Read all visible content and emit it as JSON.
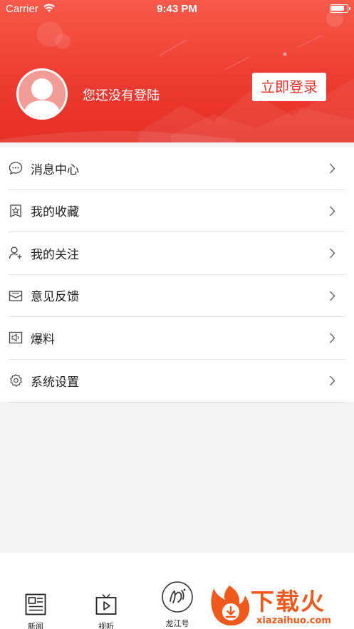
{
  "status_bar": {
    "carrier": "Carrier",
    "time": "9:43 PM"
  },
  "profile": {
    "login_hint": "您还没有登陆",
    "login_button": "立即登录"
  },
  "menu": {
    "items": [
      {
        "label": "消息中心",
        "icon": "message-icon"
      },
      {
        "label": "我的收藏",
        "icon": "bookmark-star-icon"
      },
      {
        "label": "我的关注",
        "icon": "user-add-icon"
      },
      {
        "label": "意见反馈",
        "icon": "mail-icon"
      },
      {
        "label": "爆料",
        "icon": "speaker-icon"
      },
      {
        "label": "系统设置",
        "icon": "gear-icon"
      }
    ]
  },
  "tabbar": {
    "tabs": [
      {
        "label": "新闻",
        "icon": "newspaper-icon"
      },
      {
        "label": "视听",
        "icon": "tv-play-icon"
      },
      {
        "label": "龙江号",
        "icon": "longjiang-logo-icon"
      }
    ]
  },
  "watermark": {
    "title": "下载火",
    "url": "xiazaihuo.com"
  },
  "colors": {
    "brand_red": "#e8332a",
    "watermark_orange": "#ef5a1c"
  }
}
